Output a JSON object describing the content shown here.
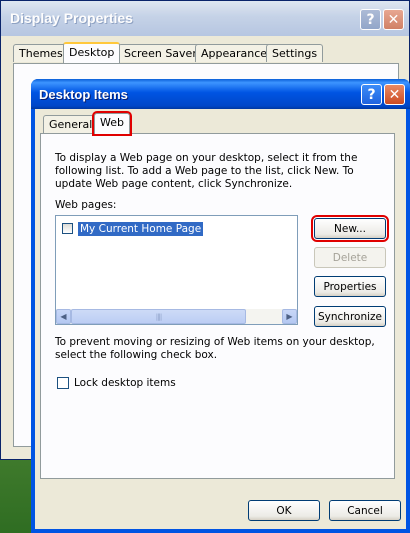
{
  "outer_window": {
    "title": "Display Properties",
    "help_glyph": "?",
    "close_glyph": "✕",
    "tabs": [
      "Themes",
      "Desktop",
      "Screen Saver",
      "Appearance",
      "Settings"
    ],
    "active_tab": "Desktop"
  },
  "dialog": {
    "title": "Desktop Items",
    "help_glyph": "?",
    "close_glyph": "✕",
    "tabs": [
      "General",
      "Web"
    ],
    "active_tab": "Web",
    "intro": "To display a Web page on your desktop, select it from the following list. To add a Web page to the list, click New.  To update Web page content, click Synchronize.",
    "web_pages_label": "Web pages:",
    "web_pages": [
      {
        "label": "My Current Home Page",
        "checked": false,
        "selected": true
      }
    ],
    "buttons": {
      "new": "New...",
      "delete": "Delete",
      "properties": "Properties",
      "synchronize": "Synchronize"
    },
    "lock_note": "To prevent moving or resizing of Web items on your desktop, select the following check box.",
    "lock_label": "Lock desktop items",
    "lock_checked": false,
    "ok": "OK",
    "cancel": "Cancel"
  },
  "scrollbar": {
    "left_arrow": "◀",
    "right_arrow": "▶",
    "thumb_grip": "||||"
  },
  "colors": {
    "title_blue": "#0054e3",
    "highlight_red": "#e00000",
    "selection_blue": "#316ac5",
    "dialog_face": "#ece9d8"
  }
}
